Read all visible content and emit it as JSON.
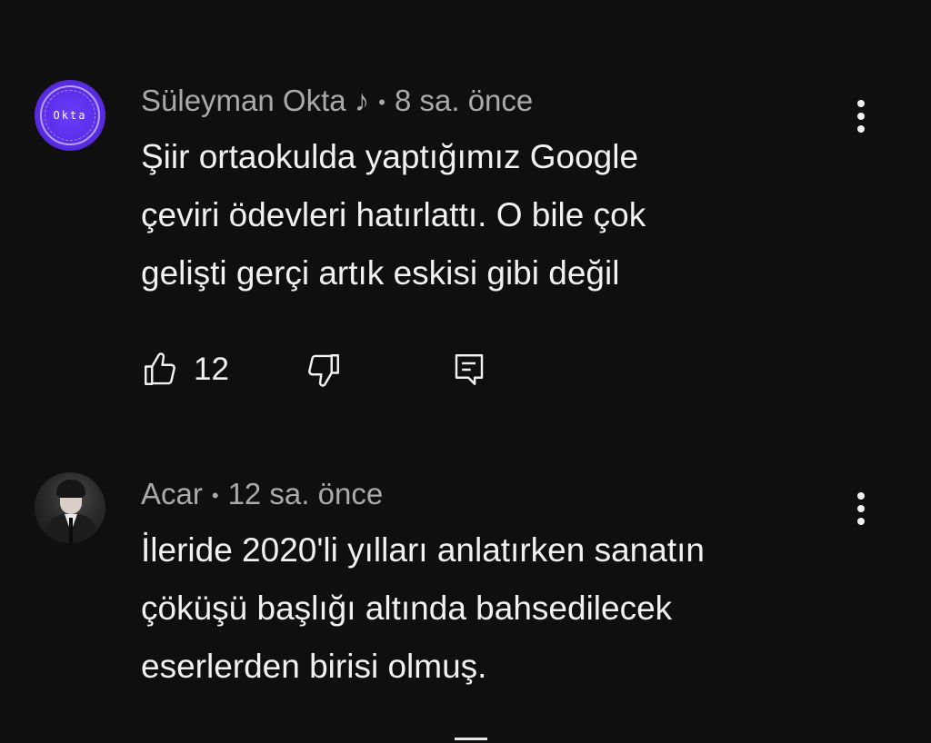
{
  "comments": [
    {
      "author": "Süleyman Okta ♪",
      "separator": "•",
      "time": "8 sa. önce",
      "avatar_logo_text": "Okta",
      "lines": [
        "Şiir ortaokulda yaptığımız Google",
        "çeviri ödevleri hatırlattı. O bile çok",
        "gelişti gerçi artık eskisi gibi değil"
      ],
      "like_count": "12",
      "icons": {
        "like": "thumbs-up-icon",
        "dislike": "thumbs-down-icon",
        "reply": "reply-icon",
        "more": "more-vertical-icon"
      }
    },
    {
      "author": "Acar",
      "separator": "•",
      "time": "12 sa. önce",
      "lines": [
        "İleride 2020'li yılları anlatırken sanatın",
        "çöküşü başlığı altında bahsedilecek",
        "eserlerden birisi olmuş."
      ],
      "icons": {
        "more": "more-vertical-icon"
      }
    }
  ],
  "colors": {
    "background": "#0f0f0f",
    "text_primary": "#f1f1f1",
    "text_secondary": "#aaaaaa",
    "avatar_accent": "#5a2ee6"
  }
}
